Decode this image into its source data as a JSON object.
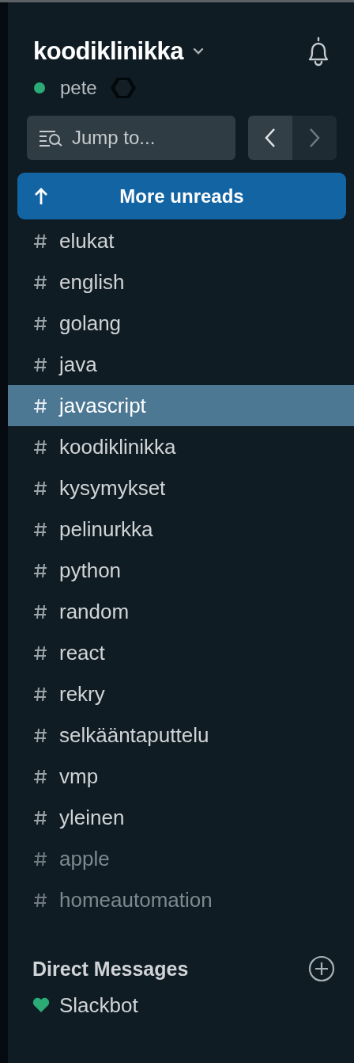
{
  "workspace": {
    "name": "koodiklinikka",
    "user": "pete",
    "online": true
  },
  "jump": {
    "placeholder": "Jump to..."
  },
  "banner": {
    "label": "More unreads"
  },
  "channels": [
    {
      "name": "elukat",
      "selected": false,
      "muted": false
    },
    {
      "name": "english",
      "selected": false,
      "muted": false
    },
    {
      "name": "golang",
      "selected": false,
      "muted": false
    },
    {
      "name": "java",
      "selected": false,
      "muted": false
    },
    {
      "name": "javascript",
      "selected": true,
      "muted": false
    },
    {
      "name": "koodiklinikka",
      "selected": false,
      "muted": false
    },
    {
      "name": "kysymykset",
      "selected": false,
      "muted": false
    },
    {
      "name": "pelinurkka",
      "selected": false,
      "muted": false
    },
    {
      "name": "python",
      "selected": false,
      "muted": false
    },
    {
      "name": "random",
      "selected": false,
      "muted": false
    },
    {
      "name": "react",
      "selected": false,
      "muted": false
    },
    {
      "name": "rekry",
      "selected": false,
      "muted": false
    },
    {
      "name": "selkääntaputtelu",
      "selected": false,
      "muted": false
    },
    {
      "name": "vmp",
      "selected": false,
      "muted": false
    },
    {
      "name": "yleinen",
      "selected": false,
      "muted": false
    },
    {
      "name": "apple",
      "selected": false,
      "muted": true
    },
    {
      "name": "homeautomation",
      "selected": false,
      "muted": true
    }
  ],
  "direct_messages": {
    "title": "Direct Messages",
    "items": [
      {
        "name": "Slackbot",
        "color": "#2bac76"
      }
    ]
  }
}
